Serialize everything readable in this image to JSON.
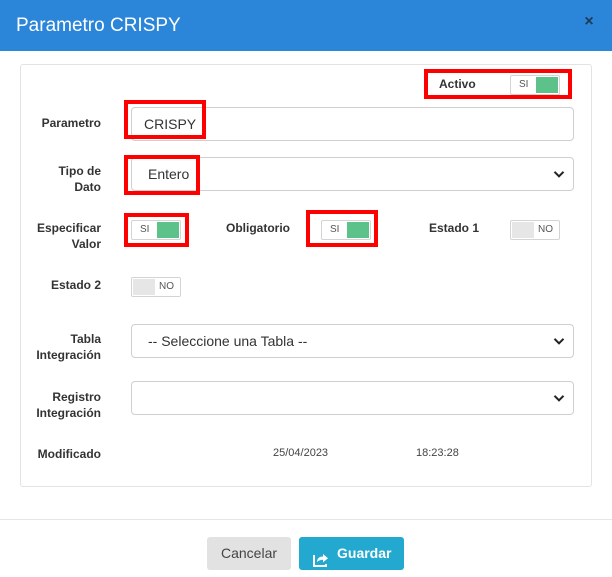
{
  "dialog": {
    "title": "Parametro CRISPY",
    "close": "×"
  },
  "fields": {
    "activo": {
      "label": "Activo",
      "toggle": "SI",
      "state": true
    },
    "parametro": {
      "label": "Parametro",
      "value": "CRISPY"
    },
    "tipo_dato": {
      "label_line1": "Tipo de",
      "label_line2": "Dato",
      "value": "Entero"
    },
    "especificar_valor": {
      "label_line1": "Especificar",
      "label_line2": "Valor",
      "toggle": "SI",
      "state": true
    },
    "obligatorio": {
      "label": "Obligatorio",
      "toggle": "SI",
      "state": true
    },
    "estado1": {
      "label": "Estado 1",
      "toggle": "NO",
      "state": false
    },
    "estado2": {
      "label": "Estado 2",
      "toggle": "NO",
      "state": false
    },
    "tabla_integracion": {
      "label_line1": "Tabla",
      "label_line2": "Integración",
      "value": "-- Seleccione una Tabla --"
    },
    "registro_integracion": {
      "label_line1": "Registro",
      "label_line2": "Integración",
      "value": ""
    },
    "modificado": {
      "label": "Modificado",
      "date": "25/04/2023",
      "time": "18:23:28"
    }
  },
  "footer": {
    "cancel": "Cancelar",
    "save": "Guardar"
  },
  "colors": {
    "header": "#2b86d9",
    "toggle_on": "#5cc28a",
    "highlight": "#ff0000",
    "save_button": "#23a9cf"
  }
}
